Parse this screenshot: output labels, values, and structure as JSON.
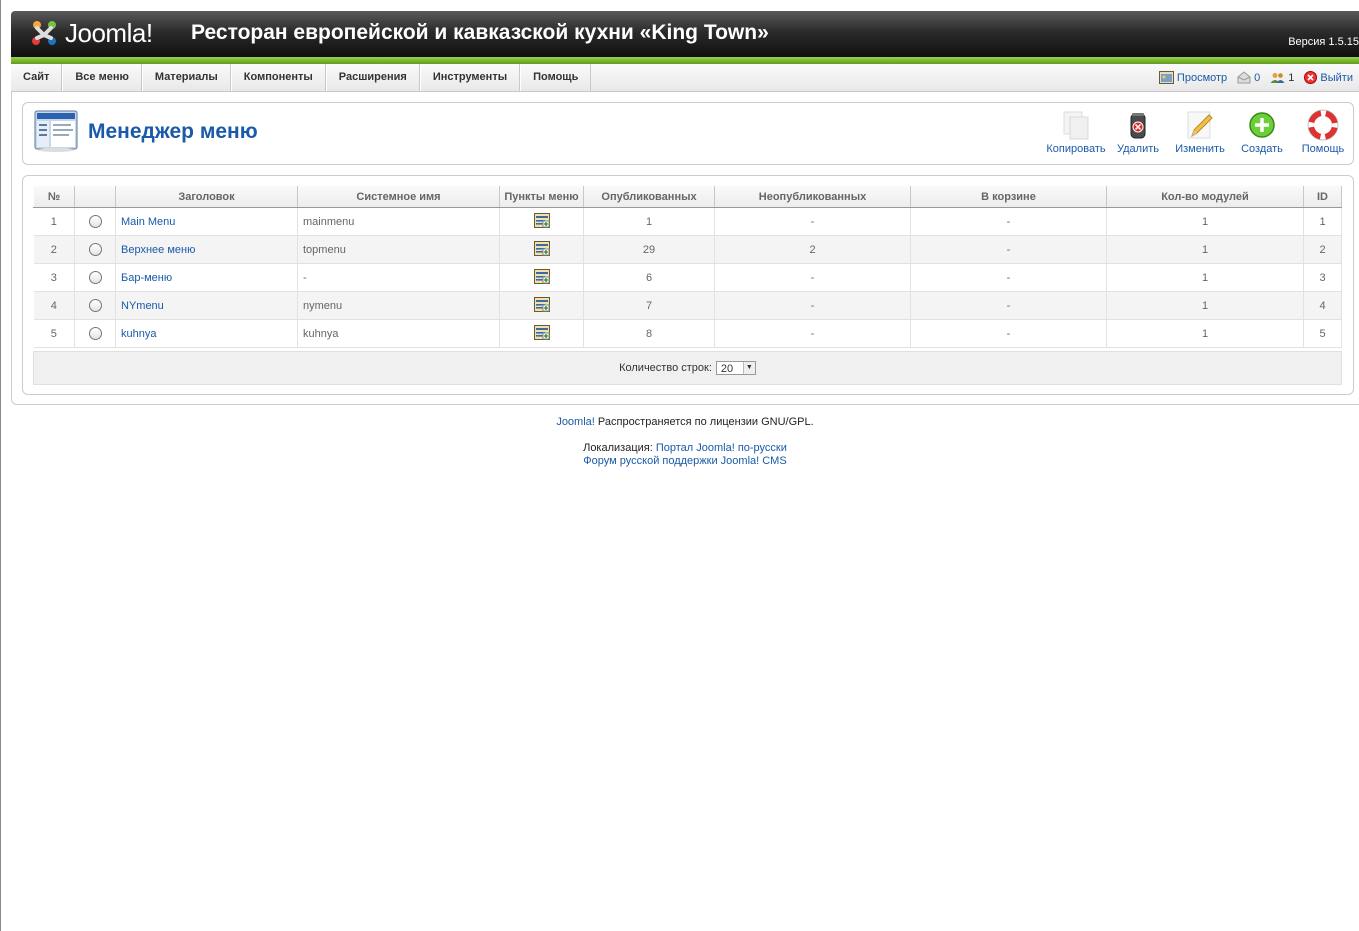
{
  "header": {
    "logo_text": "Joomla!",
    "site_title": "Ресторан европейской и кавказской кухни «King Town»",
    "version": "Версия 1.5.15"
  },
  "menubar": {
    "items": [
      "Сайт",
      "Все меню",
      "Материалы",
      "Компоненты",
      "Расширения",
      "Инструменты",
      "Помощь"
    ],
    "preview_label": "Просмотр",
    "messages_count": "0",
    "users_count": "1",
    "logout_label": "Выйти"
  },
  "toolbar": {
    "page_title": "Менеджер меню",
    "copy_label": "Копировать",
    "delete_label": "Удалить",
    "edit_label": "Изменить",
    "new_label": "Создать",
    "help_label": "Помощь"
  },
  "table": {
    "columns": [
      "№",
      "",
      "Заголовок",
      "Системное имя",
      "Пункты меню",
      "Опубликованных",
      "Неопубликованных",
      "В корзине",
      "Кол-во модулей",
      "ID"
    ],
    "rows": [
      {
        "num": "1",
        "title": "Main Menu",
        "system": "mainmenu",
        "published": "1",
        "unpublished": "-",
        "trash": "-",
        "modules": "1",
        "id": "1"
      },
      {
        "num": "2",
        "title": "Верхнее меню",
        "system": "topmenu",
        "published": "29",
        "unpublished": "2",
        "trash": "-",
        "modules": "1",
        "id": "2"
      },
      {
        "num": "3",
        "title": "Бар-меню",
        "system": "-",
        "published": "6",
        "unpublished": "-",
        "trash": "-",
        "modules": "1",
        "id": "3"
      },
      {
        "num": "4",
        "title": "NYmenu",
        "system": "nymenu",
        "published": "7",
        "unpublished": "-",
        "trash": "-",
        "modules": "1",
        "id": "4"
      },
      {
        "num": "5",
        "title": "kuhnya",
        "system": "kuhnya",
        "published": "8",
        "unpublished": "-",
        "trash": "-",
        "modules": "1",
        "id": "5"
      }
    ],
    "limit_label": "Количество строк:",
    "limit_value": "20"
  },
  "footer": {
    "joomla_link": "Joomla!",
    "license_text": " Распространяется по лицензии GNU/GPL.",
    "localization_label": "Локализация: ",
    "portal_link": "Портал Joomla! по-русски",
    "forum_link": "Форум русской поддержки Joomla! CMS"
  }
}
